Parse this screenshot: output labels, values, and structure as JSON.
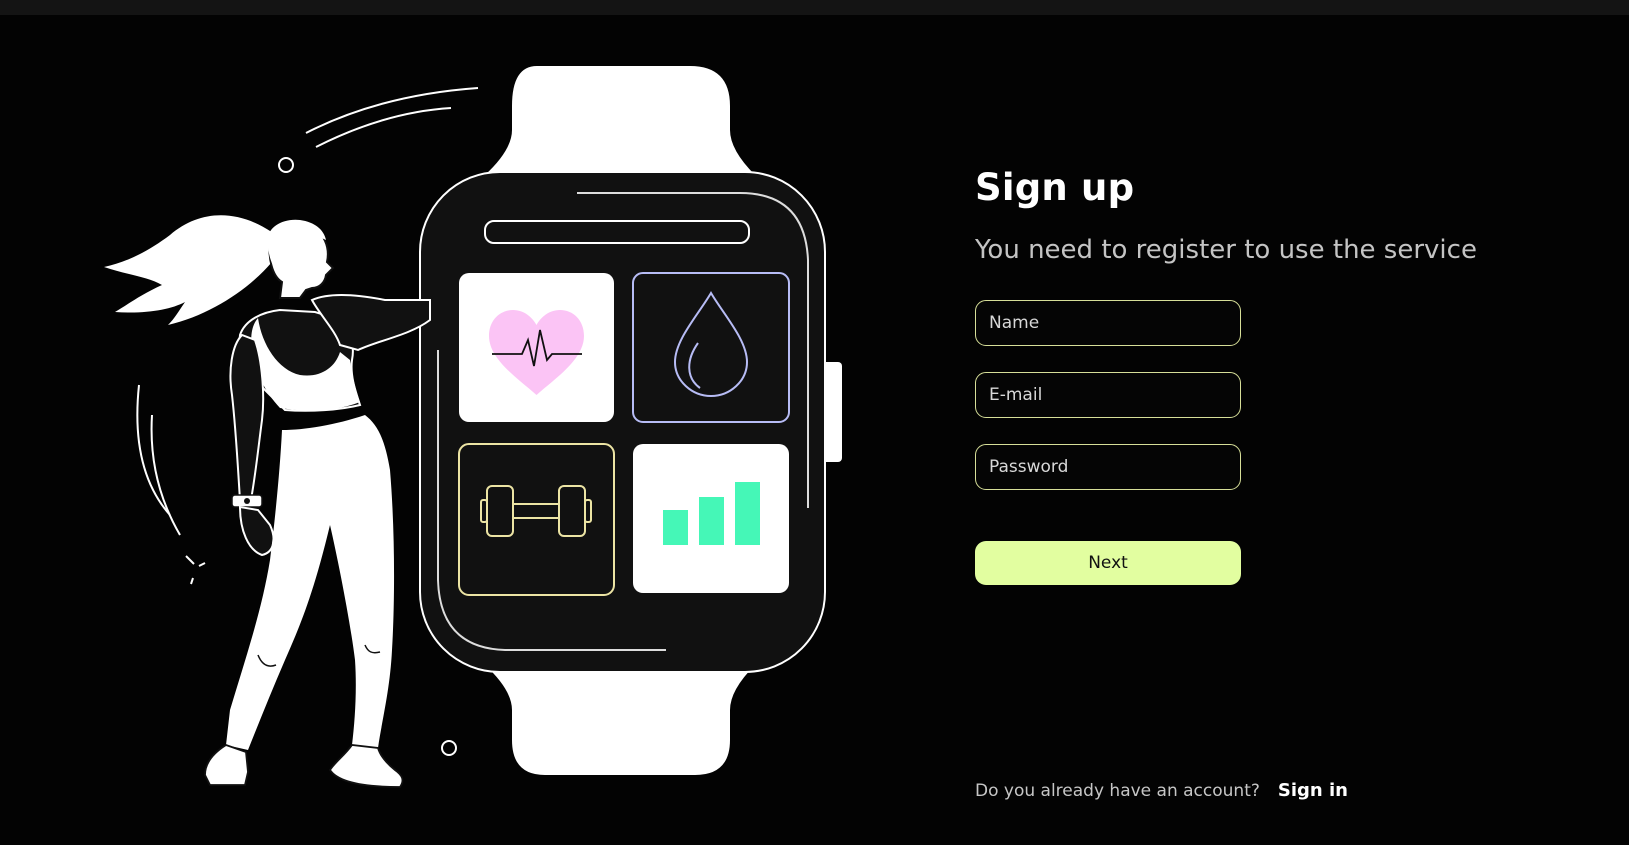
{
  "colors": {
    "background": "#030303",
    "accent": "#e2fea0",
    "field_border": "#d7df99",
    "heart": "#fbc4f5",
    "drop_outline": "#b7bcf5",
    "dumbbell_outline": "#ece4a4",
    "bars": "#45f7b7"
  },
  "illustration": {
    "icons": [
      "heart-rate-icon",
      "water-drop-icon",
      "dumbbell-icon",
      "bar-chart-icon"
    ]
  },
  "form": {
    "title": "Sign up",
    "subtitle": "You need to register to use the service",
    "name_placeholder": "Name",
    "email_placeholder": "E-mail",
    "password_placeholder": "Password",
    "next_label": "Next"
  },
  "footer": {
    "question": "Do you already have an account?",
    "signin_label": "Sign in"
  }
}
